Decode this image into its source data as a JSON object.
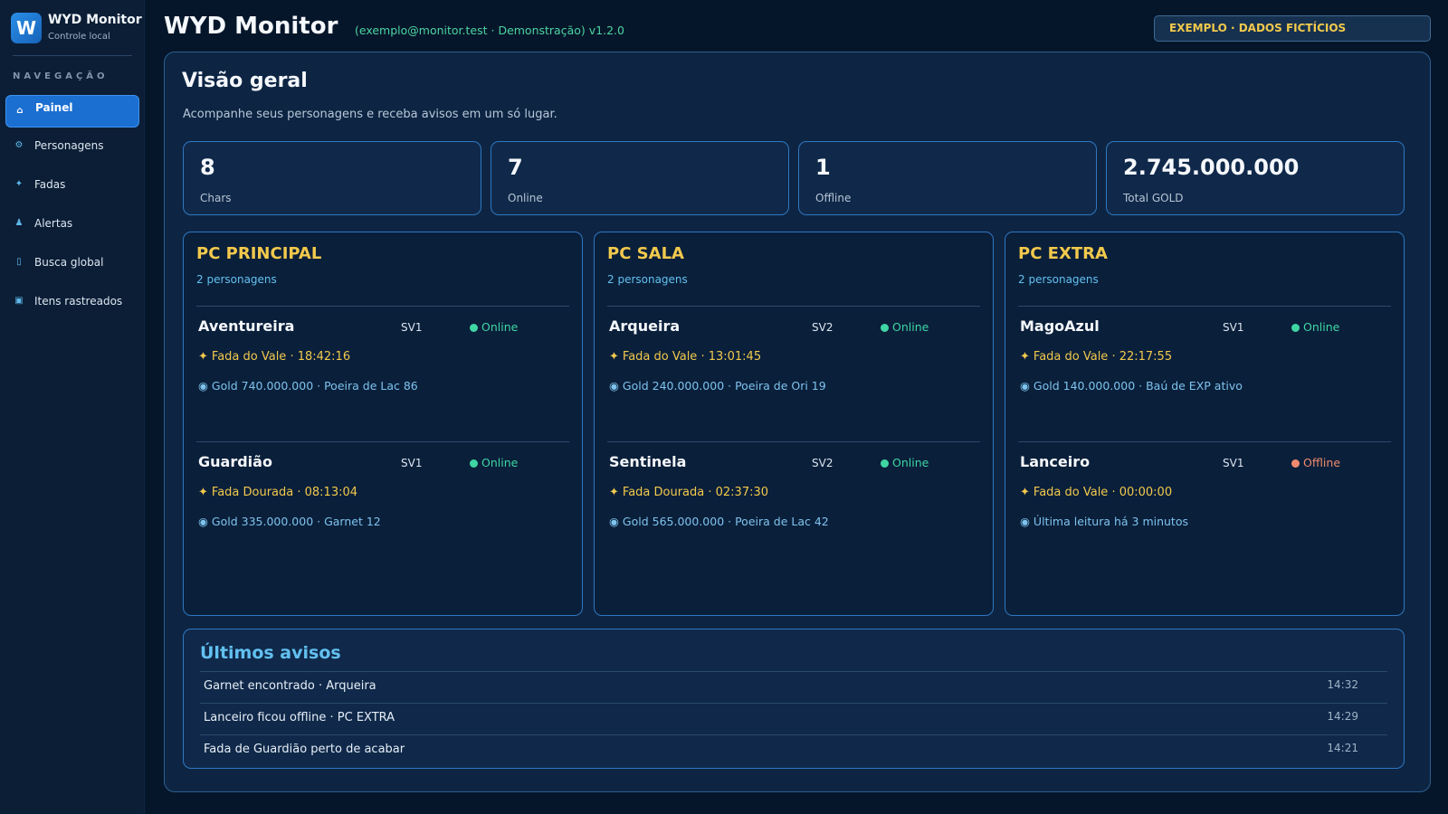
{
  "sidebar": {
    "brand_logo": "W",
    "brand_title": "WYD Monitor",
    "brand_subtitle": "Controle local",
    "nav_heading": "NAVEGAÇÃO",
    "items": [
      {
        "label": "Painel",
        "icon": "home-icon",
        "glyph": "⌂",
        "active": true
      },
      {
        "label": "Personagens",
        "icon": "gear-icon",
        "glyph": "⚙",
        "active": false
      },
      {
        "label": "Fadas",
        "icon": "sparkle-icon",
        "glyph": "✦",
        "active": false
      },
      {
        "label": "Alertas",
        "icon": "person-icon",
        "glyph": "♟",
        "active": false
      },
      {
        "label": "Busca global",
        "icon": "search-icon",
        "glyph": "▯",
        "active": false
      },
      {
        "label": "Itens rastreados",
        "icon": "box-icon",
        "glyph": "▣",
        "active": false
      }
    ]
  },
  "header": {
    "title": "WYD Monitor",
    "meta": "(exemplo@monitor.test · Demonstração)  v1.2.0",
    "badge": "EXEMPLO · DADOS FICTÍCIOS"
  },
  "overview": {
    "title": "Visão geral",
    "subtitle": "Acompanhe seus personagens e receba avisos em um só lugar."
  },
  "stats": [
    {
      "value": "8",
      "label": "Chars"
    },
    {
      "value": "7",
      "label": "Online"
    },
    {
      "value": "1",
      "label": "Offline"
    },
    {
      "value": "2.745.000.000",
      "label": "Total GOLD"
    }
  ],
  "pcs": [
    {
      "title": "PC PRINCIPAL",
      "count": "2 personagens",
      "chars": [
        {
          "name": "Aventureira",
          "server": "SV1",
          "status": "Online",
          "fada": "Fada do Vale · 18:42:16",
          "info": "Gold 740.000.000 · Poeira de Lac 86"
        },
        {
          "name": "Guardião",
          "server": "SV1",
          "status": "Online",
          "fada": "Fada Dourada · 08:13:04",
          "info": "Gold 335.000.000 · Garnet 12"
        }
      ]
    },
    {
      "title": "PC SALA",
      "count": "2 personagens",
      "chars": [
        {
          "name": "Arqueira",
          "server": "SV2",
          "status": "Online",
          "fada": "Fada do Vale · 13:01:45",
          "info": "Gold 240.000.000 · Poeira de Ori 19"
        },
        {
          "name": "Sentinela",
          "server": "SV2",
          "status": "Online",
          "fada": "Fada Dourada · 02:37:30",
          "info": "Gold 565.000.000 · Poeira de Lac 42"
        }
      ]
    },
    {
      "title": "PC EXTRA",
      "count": "2 personagens",
      "chars": [
        {
          "name": "MagoAzul",
          "server": "SV1",
          "status": "Online",
          "fada": "Fada do Vale · 22:17:55",
          "info": "Gold 140.000.000 · Baú de EXP ativo"
        },
        {
          "name": "Lanceiro",
          "server": "SV1",
          "status": "Offline",
          "fada": "Fada do Vale · 00:00:00",
          "info": "Última leitura há 3 minutos"
        }
      ]
    }
  ],
  "glyphs": {
    "fada": "✦",
    "info": "◉"
  },
  "alerts": {
    "title": "Últimos avisos",
    "items": [
      {
        "text": "Garnet encontrado · Arqueira",
        "time": "14:32"
      },
      {
        "text": "Lanceiro ficou offline · PC EXTRA",
        "time": "14:29"
      },
      {
        "text": "Fada de Guardião perto de acabar",
        "time": "14:21"
      }
    ]
  },
  "colors": {
    "background": "#06162a",
    "sidebar": "#0b1e36",
    "accent": "#1b6fd1",
    "gold": "#f2c94c",
    "online": "#3fd6a4",
    "offline": "#f08a6e",
    "info": "#7ec3ee"
  }
}
